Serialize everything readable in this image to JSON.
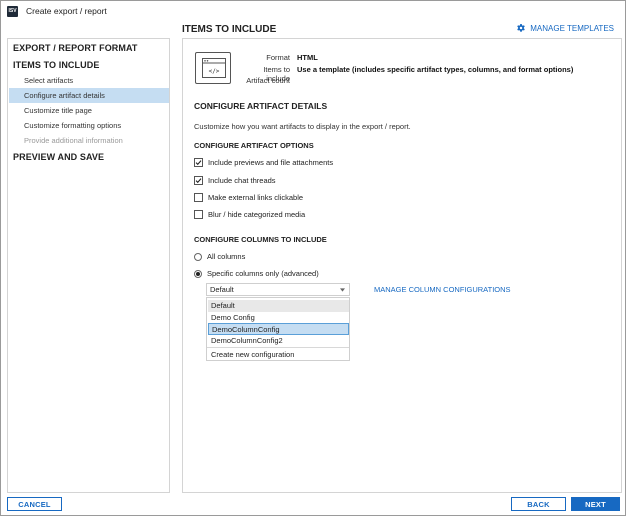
{
  "window": {
    "title": "Create export / report",
    "app_icon_text": "ISV"
  },
  "sidebar": {
    "sections": [
      {
        "label": "EXPORT / REPORT FORMAT"
      },
      {
        "label": "ITEMS TO INCLUDE"
      },
      {
        "label": "PREVIEW AND SAVE"
      }
    ],
    "items": [
      {
        "label": "Select artifacts",
        "state": "normal"
      },
      {
        "label": "Configure artifact details",
        "state": "selected"
      },
      {
        "label": "Customize title page",
        "state": "normal"
      },
      {
        "label": "Customize formatting options",
        "state": "normal"
      },
      {
        "label": "Provide additional information",
        "state": "disabled"
      }
    ]
  },
  "header": {
    "title": "ITEMS TO INCLUDE",
    "manage_templates": "MANAGE TEMPLATES"
  },
  "summary": {
    "format_label": "Format",
    "format_value": "HTML",
    "items_label": "Items to include",
    "items_value": "Use a template (includes specific artifact types, columns, and format options)",
    "count_label": "Artifact count",
    "count_value": ""
  },
  "details": {
    "heading": "CONFIGURE ARTIFACT DETAILS",
    "description": "Customize how you want artifacts to display in the export / report.",
    "options_heading": "CONFIGURE ARTIFACT OPTIONS",
    "options": [
      {
        "label": "Include previews and file attachments",
        "checked": true
      },
      {
        "label": "Include chat threads",
        "checked": true
      },
      {
        "label": "Make external links clickable",
        "checked": false
      },
      {
        "label": "Blur / hide categorized media",
        "checked": false
      }
    ],
    "columns_heading": "CONFIGURE COLUMNS TO INCLUDE",
    "columns_options": [
      {
        "label": "All columns",
        "selected": false
      },
      {
        "label": "Specific columns only (advanced)",
        "selected": true
      }
    ],
    "dropdown_value": "Default",
    "dropdown_options": [
      "Default",
      "Demo Config",
      "DemoColumnConfig",
      "DemoColumnConfig2"
    ],
    "dropdown_create": "Create new configuration",
    "manage_columns": "MANAGE COLUMN CONFIGURATIONS"
  },
  "footer": {
    "cancel": "CANCEL",
    "back": "BACK",
    "next": "NEXT"
  },
  "colors": {
    "accent": "#1769c2",
    "selection": "#c5ddf2"
  }
}
